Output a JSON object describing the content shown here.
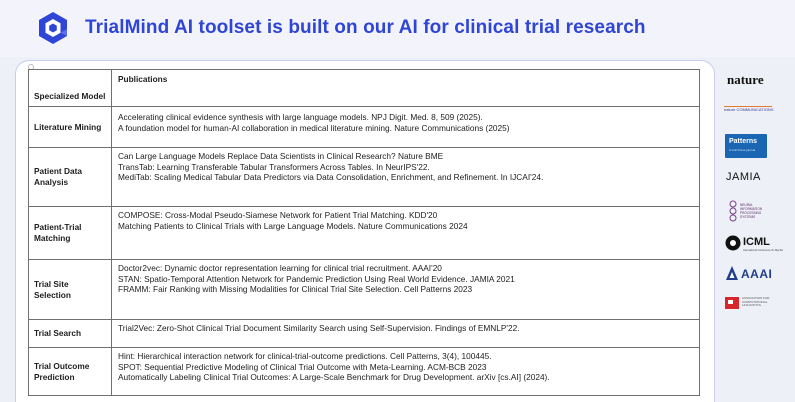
{
  "header": {
    "title": "TrialMind AI toolset is built on our AI for clinical trial research"
  },
  "table": {
    "columns": [
      "Specialized Model",
      "Publications"
    ],
    "rows": [
      {
        "model": "Literature Mining",
        "publications": [
          "Accelerating clinical evidence synthesis with large language models. NPJ Digit. Med. 8, 509 (2025).",
          "A foundation model for human-AI collaboration in medical literature mining. Nature Communications (2025)"
        ]
      },
      {
        "model": "Patient Data Analysis",
        "publications": [
          "Can Large Language Models Replace Data Scientists in Clinical Research? Nature BME",
          "TransTab: Learning Transferable Tabular Transformers Across Tables. In NeurIPS'22.",
          "MediTab: Scaling Medical Tabular Data Predictors via Data Consolidation, Enrichment, and Refinement. In IJCAI'24."
        ]
      },
      {
        "model": "Patient-Trial Matching",
        "publications": [
          "COMPOSE: Cross-Modal Pseudo-Siamese Network for Patient Trial Matching. KDD'20",
          "Matching Patients to Clinical Trials with Large Language Models. Nature Communications 2024"
        ]
      },
      {
        "model": "Trial Site Selection",
        "publications": [
          "Doctor2vec: Dynamic doctor representation learning for clinical trial recruitment. AAAI'20",
          "STAN: Spatio-Temporal Attention Network for Pandemic Prediction Using Real World Evidence. JAMIA 2021",
          "FRAMM: Fair Ranking with Missing Modalities for Clinical Trial Site Selection. Cell Patterns 2023"
        ]
      },
      {
        "model": "Trial Search",
        "publications": [
          "Trial2Vec: Zero-Shot Clinical Trial Document Similarity Search using Self-Supervision. Findings of EMNLP'22."
        ]
      },
      {
        "model": "Trial Outcome Prediction",
        "publications": [
          "Hint: Hierarchical interaction network for clinical-trial-outcome predictions. Cell Patterns, 3(4), 100445.",
          "SPOT: Sequential Predictive Modeling of Clinical Trial Outcome with Meta-Learning. ACM-BCB 2023",
          "Automatically Labeling Clinical Trial Outcomes: A Large-Scale Benchmark for Drug Development. arXiv [cs.AI] (2024)."
        ]
      }
    ]
  },
  "venues": {
    "nature": "nature",
    "nature_comms": "nature COMMUNICATIONS",
    "patterns": "Patterns",
    "patterns_sub": "A Cell Press journal",
    "jamia": "JAMIA",
    "neurips": "NEURAL INFORMATION PROCESSING SYSTEMS",
    "icml": "ICML",
    "icml_sub": "International Conference On Machine Learning",
    "aaai": "AAAI",
    "acl": "ASSOCIATION FOR COMPUTATIONAL LINGUISTICS"
  },
  "colors": {
    "title": "#2f45d6",
    "card_border": "#c7cdf0",
    "patterns_bg": "#1a66b3"
  }
}
